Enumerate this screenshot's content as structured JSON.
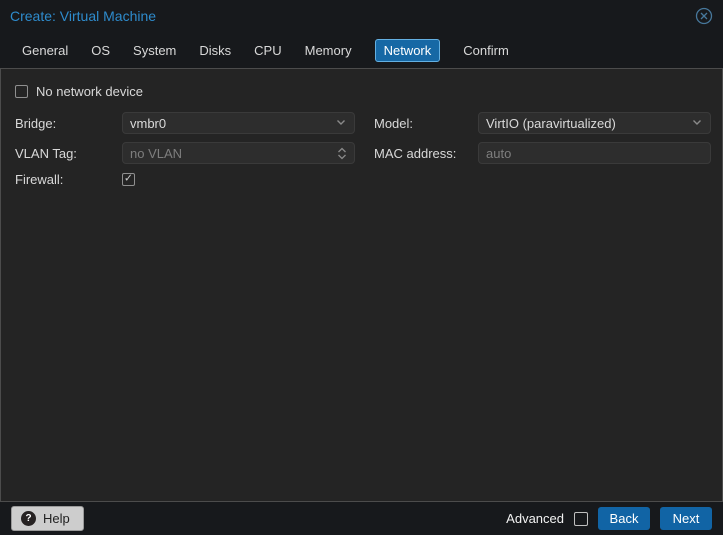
{
  "dialog": {
    "title": "Create: Virtual Machine"
  },
  "tabs": [
    {
      "label": "General",
      "active": false
    },
    {
      "label": "OS",
      "active": false
    },
    {
      "label": "System",
      "active": false
    },
    {
      "label": "Disks",
      "active": false
    },
    {
      "label": "CPU",
      "active": false
    },
    {
      "label": "Memory",
      "active": false
    },
    {
      "label": "Network",
      "active": true
    },
    {
      "label": "Confirm",
      "active": false
    }
  ],
  "form": {
    "no_network_device": {
      "label": "No network device",
      "checked": false
    },
    "bridge": {
      "label": "Bridge:",
      "value": "vmbr0"
    },
    "model": {
      "label": "Model:",
      "value": "VirtIO (paravirtualized)"
    },
    "vlan_tag": {
      "label": "VLAN Tag:",
      "value": "no VLAN",
      "disabled": true
    },
    "mac_address": {
      "label": "MAC address:",
      "placeholder": "auto"
    },
    "firewall": {
      "label": "Firewall:",
      "checked": true,
      "checkmark": "✓"
    }
  },
  "footer": {
    "help_label": "Help",
    "help_glyph": "?",
    "advanced_label": "Advanced",
    "advanced_checked": false,
    "back_label": "Back",
    "next_label": "Next"
  },
  "colors": {
    "title_blue": "#2e8bcc",
    "accent_blue": "#1164a5",
    "active_tab_bg": "#1668a5",
    "active_tab_border": "#64b0e2",
    "panel_bg": "#242424",
    "header_bg": "#17191c",
    "field_bg": "#2d2d2d",
    "text": "#d9d9d9",
    "muted_text": "#7e7e7e"
  }
}
